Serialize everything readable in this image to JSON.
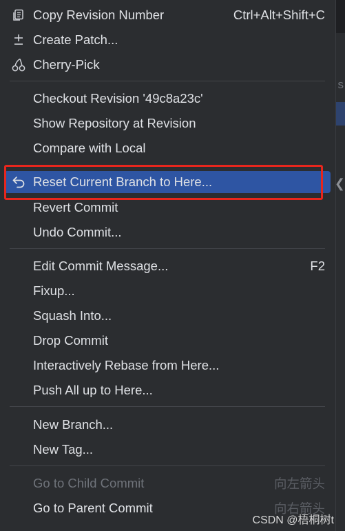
{
  "menu": {
    "copy_revision": {
      "label": "Copy Revision Number",
      "shortcut": "Ctrl+Alt+Shift+C",
      "icon": "copy-icon"
    },
    "create_patch": {
      "label": "Create Patch...",
      "icon": "plus-minus-icon"
    },
    "cherry_pick": {
      "label": "Cherry-Pick",
      "icon": "cherry-icon"
    },
    "checkout_revision": {
      "label": "Checkout Revision '49c8a23c'"
    },
    "show_repository": {
      "label": "Show Repository at Revision"
    },
    "compare_local": {
      "label": "Compare with Local"
    },
    "reset_branch": {
      "label": "Reset Current Branch to Here...",
      "icon": "undo-arrow-icon",
      "selected": true
    },
    "revert_commit": {
      "label": "Revert Commit"
    },
    "undo_commit": {
      "label": "Undo Commit..."
    },
    "edit_message": {
      "label": "Edit Commit Message...",
      "shortcut": "F2"
    },
    "fixup": {
      "label": "Fixup..."
    },
    "squash": {
      "label": "Squash Into..."
    },
    "drop_commit": {
      "label": "Drop Commit"
    },
    "interactive_rebase": {
      "label": "Interactively Rebase from Here..."
    },
    "push_all": {
      "label": "Push All up to Here..."
    },
    "new_branch": {
      "label": "New Branch..."
    },
    "new_tag": {
      "label": "New Tag..."
    },
    "go_child": {
      "label": "Go to Child Commit",
      "shortcut": "向左箭头",
      "disabled": true
    },
    "go_parent": {
      "label": "Go to Parent Commit",
      "shortcut": "向右箭头"
    }
  },
  "background": {
    "fragment": "s"
  },
  "watermark": "CSDN @梧桐树t",
  "colors": {
    "menu_bg": "#2b2d30",
    "selection": "#2e55a3",
    "highlight_box": "#e8261d",
    "text": "#dfe1e5",
    "disabled_text": "#6f737a"
  }
}
